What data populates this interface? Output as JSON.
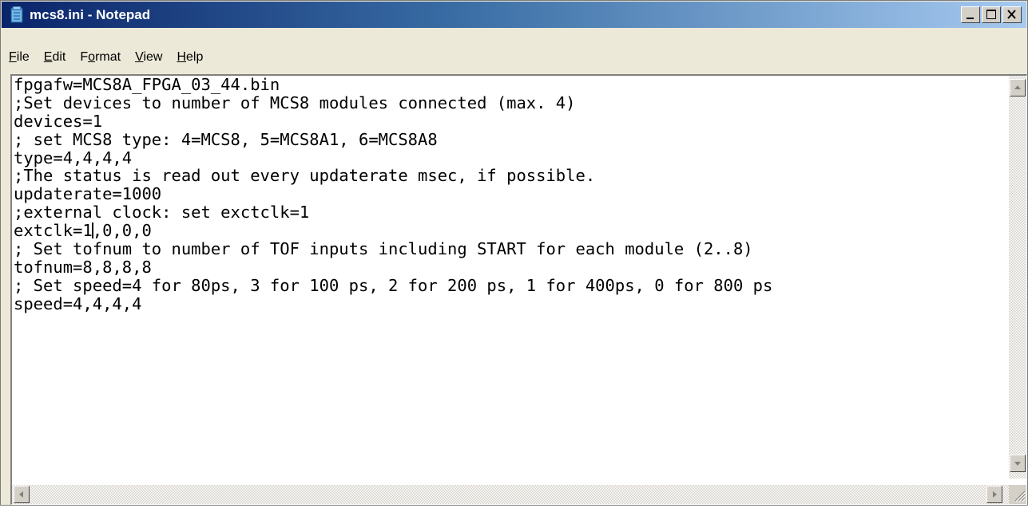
{
  "window": {
    "title": "mcs8.ini - Notepad",
    "icon": "notepad-icon"
  },
  "caption_buttons": [
    "minimize-icon",
    "maximize-icon",
    "close-icon"
  ],
  "menu": {
    "items": [
      {
        "accel": "F",
        "rest": "ile"
      },
      {
        "accel": "E",
        "rest": "dit"
      },
      {
        "pre": "F",
        "accel": "o",
        "rest": "rmat"
      },
      {
        "accel": "V",
        "rest": "iew"
      },
      {
        "accel": "H",
        "rest": "elp"
      }
    ]
  },
  "document": {
    "lines": [
      "fpgafw=MCS8A_FPGA_03_44.bin",
      ";Set devices to number of MCS8 modules connected (max. 4)",
      "devices=1",
      "; set MCS8 type: 4=MCS8, 5=MCS8A1, 6=MCS8A8",
      "type=4,4,4,4",
      ";The status is read out every updaterate msec, if possible.",
      "updaterate=1000",
      ";external clock: set exctclk=1",
      "extclk=1,0,0,0",
      "; Set tofnum to number of TOF inputs including START for each module (2..8)",
      "tofnum=8,8,8,8",
      "; Set speed=4 for 80ps, 3 for 100 ps, 2 for 200 ps, 1 for 400ps, 0 for 800 ps",
      "speed=4,4,4,4"
    ],
    "caret": {
      "line": 9,
      "column": 8
    }
  },
  "colors": {
    "titlebar_start": "#0a246a",
    "titlebar_end": "#a6caf0",
    "chrome": "#ece9d8"
  }
}
